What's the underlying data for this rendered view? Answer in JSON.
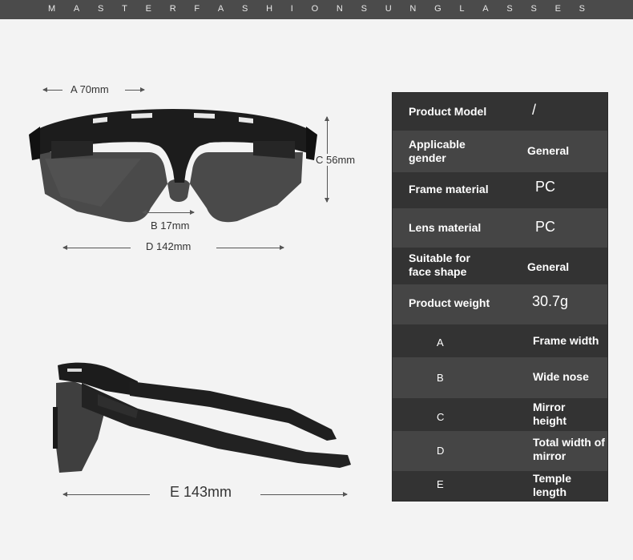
{
  "banner": {
    "letters": [
      "M",
      "A",
      "S",
      "T",
      "E",
      "R",
      "F",
      "A",
      "S",
      "H",
      "I",
      "O",
      "N",
      "S",
      "U",
      "N",
      "G",
      "L",
      "A",
      "S",
      "S",
      "E",
      "S"
    ]
  },
  "front_view": {
    "a_label": "A 70mm",
    "b_label": "B 17mm",
    "c_label": "C 56mm",
    "d_label": "D 142mm"
  },
  "side_view": {
    "e_label": "E 143mm"
  },
  "specs": [
    {
      "label": "Product Model",
      "value": "/"
    },
    {
      "label": "Applicable gender",
      "value": "General"
    },
    {
      "label": "Frame material",
      "value": "PC"
    },
    {
      "label": "Lens material",
      "value": "PC"
    },
    {
      "label": "Suitable for face shape",
      "value": "General"
    },
    {
      "label": "Product weight",
      "value": "30.7g"
    }
  ],
  "dimensions": [
    {
      "letter": "A",
      "name": "Frame width"
    },
    {
      "letter": "B",
      "name": "Wide nose"
    },
    {
      "letter": "C",
      "name": "Mirror height"
    },
    {
      "letter": "D",
      "name": "Total width of mirror"
    },
    {
      "letter": "E",
      "name": "Temple length"
    }
  ],
  "colors": {
    "banner": "#4b4b4b",
    "table_dark": "#333333",
    "table_light": "#454545",
    "lens": "#4a4a4a",
    "frame": "#1c1c1c"
  }
}
